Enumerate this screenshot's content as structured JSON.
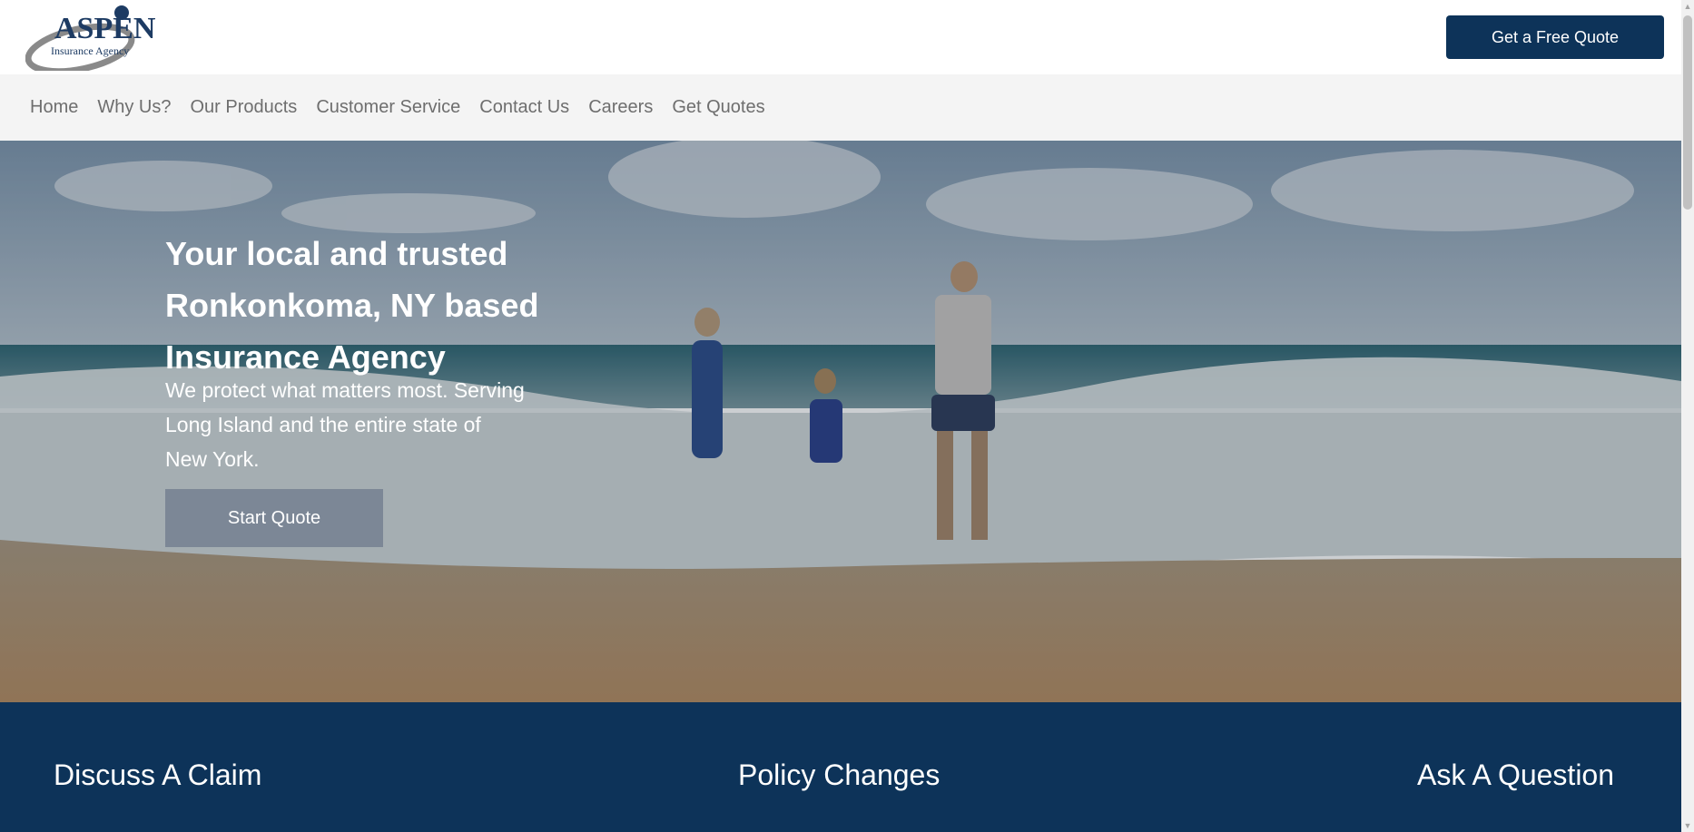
{
  "header": {
    "logo_text": "ASPEN",
    "logo_sub": "Insurance Agency",
    "quote_button": "Get a Free Quote"
  },
  "nav": {
    "items": [
      "Home",
      "Why Us?",
      "Our Products",
      "Customer Service",
      "Contact Us",
      "Careers",
      "Get Quotes"
    ]
  },
  "hero": {
    "title": "Your local and trusted Ronkonkoma, NY based Insurance Agency",
    "subtitle": "We protect what matters most. Serving Long Island and the entire state of New York.",
    "cta": "Start Quote"
  },
  "services": {
    "items": [
      "Discuss A Claim",
      "Policy Changes",
      "Ask A Question"
    ]
  },
  "colors": {
    "brand_navy": "#0d3359",
    "nav_bg": "#f4f4f4",
    "cta_gray": "#7c8796"
  }
}
